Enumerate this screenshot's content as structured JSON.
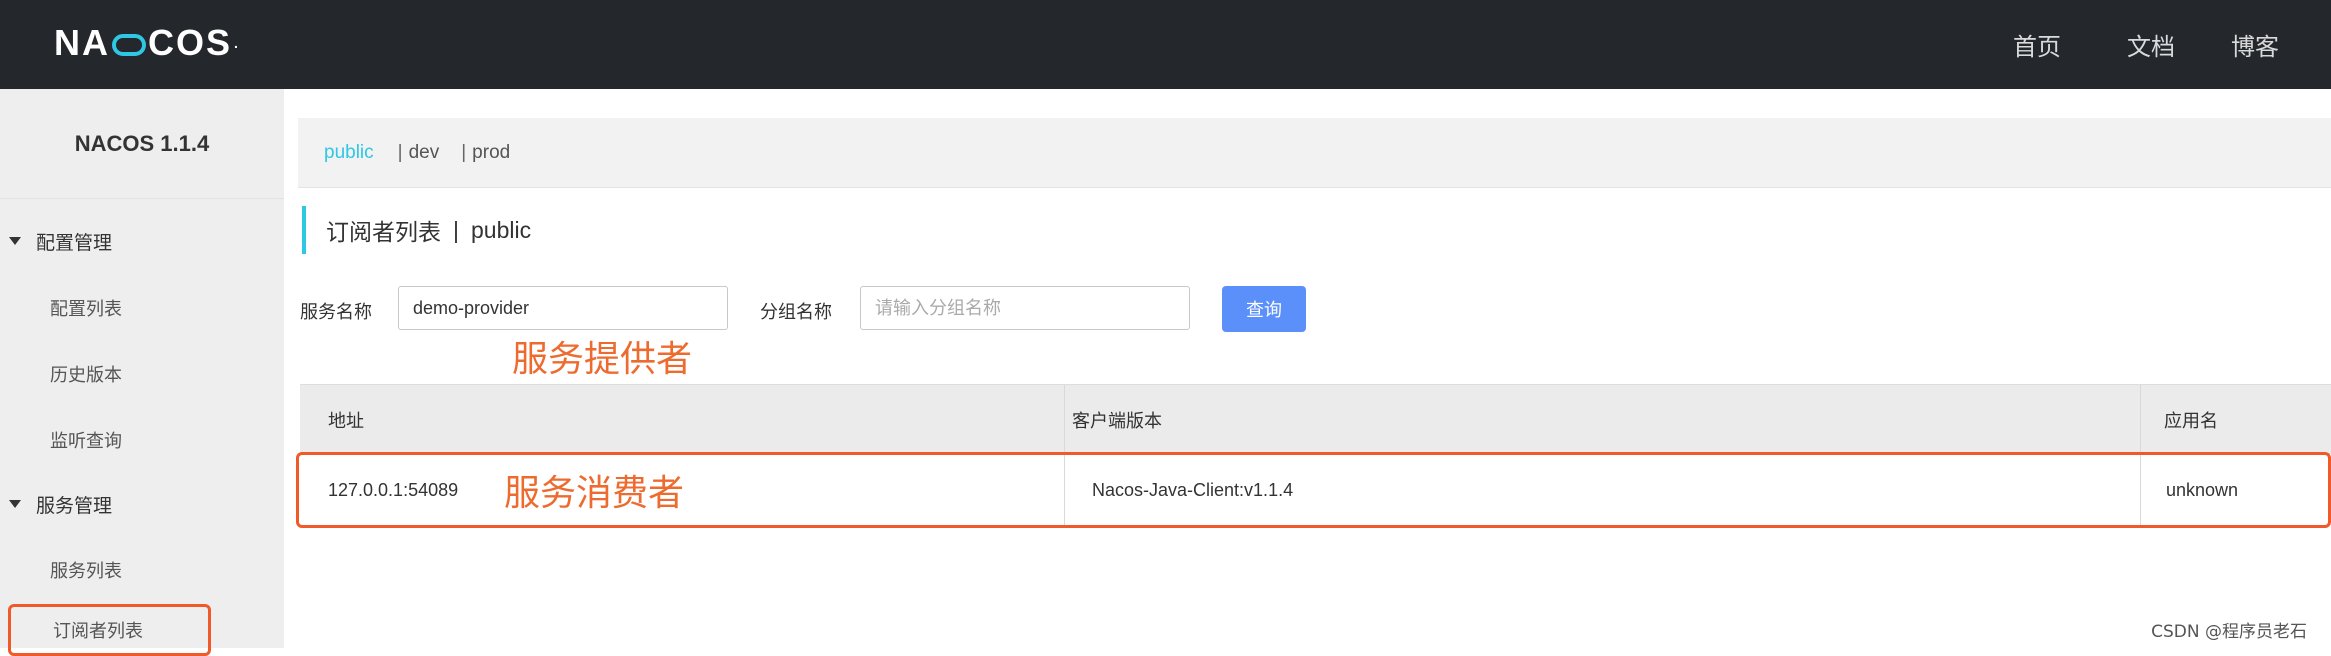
{
  "header": {
    "logo_text_1": "NA",
    "logo_text_2": "COS",
    "logo_dot": ".",
    "nav": [
      "首页",
      "文档",
      "博客"
    ]
  },
  "sidebar": {
    "version": "NACOS 1.1.4",
    "groups": [
      {
        "label": "配置管理",
        "items": [
          "配置列表",
          "历史版本",
          "监听查询"
        ]
      },
      {
        "label": "服务管理",
        "items": [
          "服务列表",
          "订阅者列表"
        ]
      }
    ],
    "active_item": "订阅者列表"
  },
  "namespace_tabs": {
    "active": "public",
    "others": [
      "dev",
      "prod"
    ],
    "separator": "|"
  },
  "page": {
    "title": "订阅者列表",
    "title_sep": "|",
    "title_ns": "public"
  },
  "search": {
    "service_label": "服务名称",
    "service_value": "demo-provider",
    "group_label": "分组名称",
    "group_placeholder": "请输入分组名称",
    "query_button": "查询"
  },
  "annotations": {
    "provider": "服务提供者",
    "consumer": "服务消费者"
  },
  "table": {
    "columns": [
      "地址",
      "客户端版本",
      "应用名"
    ],
    "rows": [
      [
        "127.0.0.1:54089",
        "Nacos-Java-Client:v1.1.4",
        "unknown"
      ]
    ]
  },
  "watermark": "CSDN @程序员老石",
  "colors": {
    "accent": "#2ec7e4",
    "highlight": "#f05a2b",
    "annotation": "#ee6b2f",
    "button": "#5b8ff9",
    "topbar": "#24272b"
  }
}
